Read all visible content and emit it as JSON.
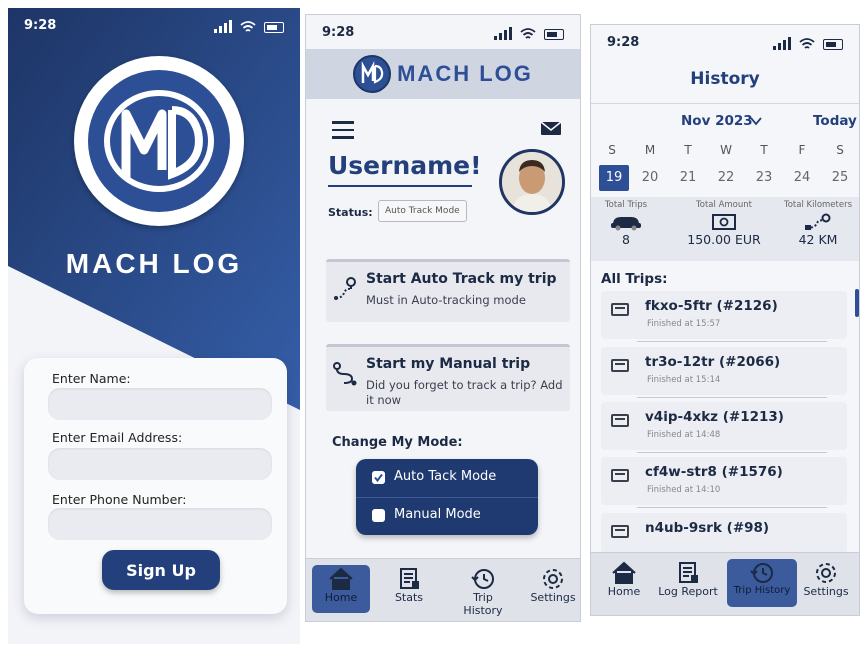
{
  "status_bar": {
    "time": "9:28"
  },
  "signin": {
    "brand": "MACH LOG",
    "name_label": "Enter Name:",
    "email_label": "Enter Email Address:",
    "phone_label": "Enter Phone Number:",
    "signup_label": "Sign Up"
  },
  "home": {
    "brand": "MACH LOG",
    "username": "Username!",
    "status_label": "Status:",
    "status_value": "Auto Track Mode",
    "actions": [
      {
        "title": "Start Auto Track my trip",
        "subtitle": "Must in Auto-tracking mode",
        "icon": "route-pin-icon"
      },
      {
        "title": "Start my Manual trip",
        "subtitle": "Did you forget to track a trip? Add it now",
        "icon": "route-icon"
      }
    ],
    "mode_heading": "Change My Mode:",
    "modes": [
      {
        "label": "Auto Tack Mode",
        "checked": true
      },
      {
        "label": "Manual Mode",
        "checked": false
      }
    ],
    "nav": [
      {
        "label": "Home",
        "icon": "home-icon",
        "active": true
      },
      {
        "label": "Stats",
        "icon": "report-icon",
        "active": false
      },
      {
        "label": "Trip History",
        "icon": "history-icon",
        "active": false
      },
      {
        "label": "Settings",
        "icon": "gear-icon",
        "active": false
      }
    ]
  },
  "history": {
    "title": "History",
    "month": "Nov 2023",
    "today_label": "Today",
    "weekdays": [
      "S",
      "M",
      "T",
      "W",
      "T",
      "F",
      "S"
    ],
    "dates": [
      "19",
      "20",
      "21",
      "22",
      "23",
      "24",
      "25"
    ],
    "selected_date": "19",
    "stats": [
      {
        "label": "Total Trips",
        "value": "8",
        "icon": "car-icon"
      },
      {
        "label": "Total Amount",
        "value": "150.00 EUR",
        "icon": "money-icon"
      },
      {
        "label": "Total Kilometers",
        "value": "42 KM",
        "icon": "route-icon"
      }
    ],
    "all_trips_label": "All Trips:",
    "trips": [
      {
        "name": "fkxo-5ftr (#2126)",
        "time": "Finished at 15:57"
      },
      {
        "name": "tr3o-12tr (#2066)",
        "time": "Finished at 15:14"
      },
      {
        "name": "v4ip-4xkz (#1213)",
        "time": "Finished at 14:48"
      },
      {
        "name": "cf4w-str8 (#1576)",
        "time": "Finished at 14:10"
      },
      {
        "name": "n4ub-9srk (#98)",
        "time": ""
      }
    ],
    "nav": [
      {
        "label": "Home",
        "icon": "home-icon",
        "active": false
      },
      {
        "label": "Log Report",
        "icon": "report-icon",
        "active": false
      },
      {
        "label": "Trip History",
        "icon": "history-icon",
        "active": true
      },
      {
        "label": "Settings",
        "icon": "gear-icon",
        "active": false
      }
    ]
  },
  "colors": {
    "brand_blue": "#2d4f96",
    "navy": "#1f3a70",
    "dark_text": "#1c2a44"
  }
}
